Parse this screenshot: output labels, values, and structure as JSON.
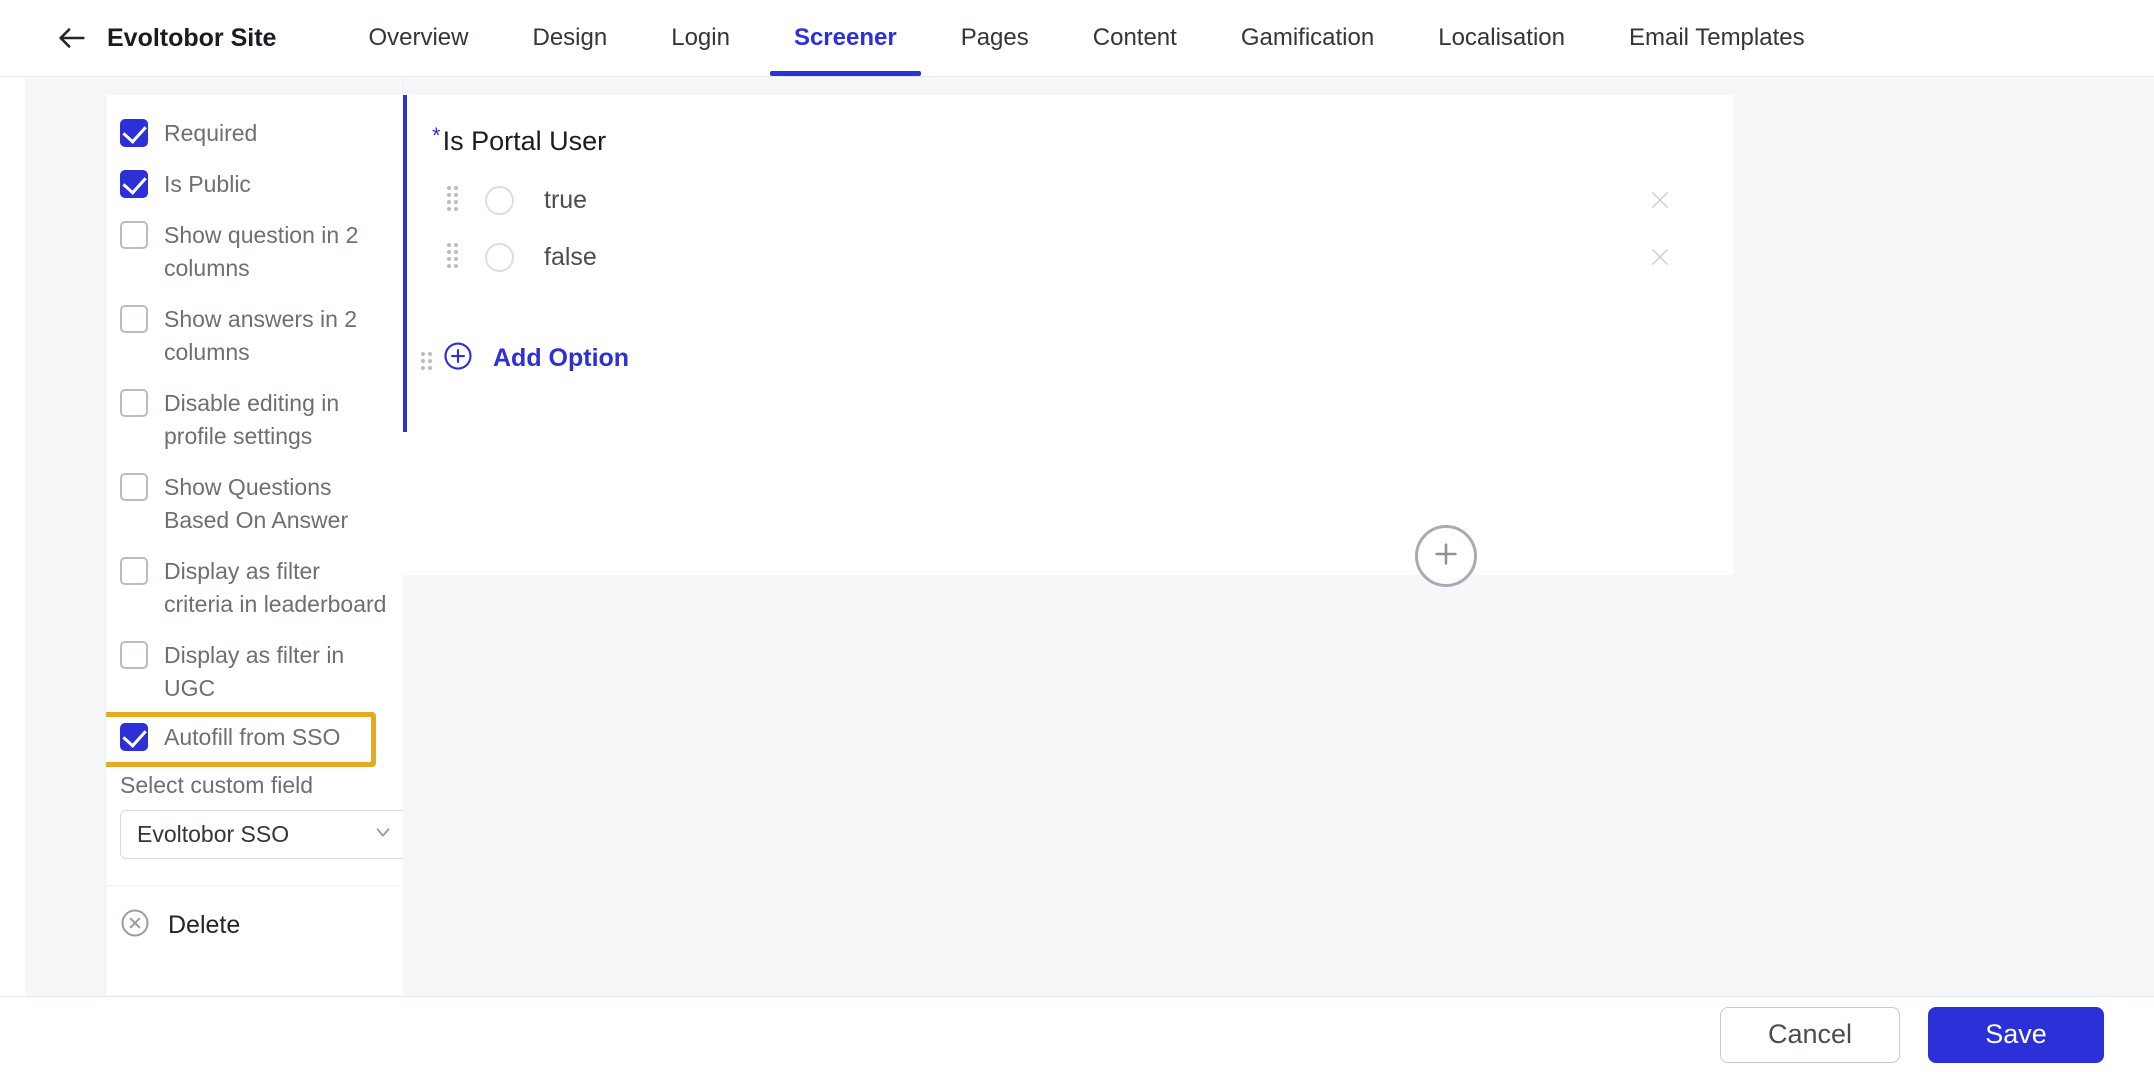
{
  "topnav": {
    "back_icon": "arrow-left-icon",
    "site_title": "Evoltobor Site",
    "tabs": [
      {
        "label": "Overview",
        "active": false
      },
      {
        "label": "Design",
        "active": false
      },
      {
        "label": "Login",
        "active": false
      },
      {
        "label": "Screener",
        "active": true
      },
      {
        "label": "Pages",
        "active": false
      },
      {
        "label": "Content",
        "active": false
      },
      {
        "label": "Gamification",
        "active": false
      },
      {
        "label": "Localisation",
        "active": false
      },
      {
        "label": "Email Templates",
        "active": false
      }
    ]
  },
  "sidebar": {
    "checkboxes": [
      {
        "label": "Required",
        "checked": true
      },
      {
        "label": "Is Public",
        "checked": true
      },
      {
        "label": "Show question in 2 columns",
        "checked": false
      },
      {
        "label": "Show answers in 2 columns",
        "checked": false
      },
      {
        "label": "Disable editing in profile settings",
        "checked": false
      },
      {
        "label": "Show Questions Based On Answer",
        "checked": false
      },
      {
        "label": "Display as filter criteria in leaderboard",
        "checked": false
      },
      {
        "label": "Display as filter in UGC",
        "checked": false
      }
    ],
    "autofill": {
      "label": "Autofill from SSO",
      "checked": true,
      "highlighted": true
    },
    "custom_field": {
      "label": "Select custom field",
      "value": "Evoltobor SSO",
      "chevron_icon": "chevron-down-icon"
    },
    "delete": {
      "label": "Delete",
      "icon": "close-circle-icon"
    }
  },
  "editor": {
    "question": {
      "required_marker": "*",
      "title": "Is Portal User",
      "drag_handle_icon": "drag-handle-icon",
      "options": [
        {
          "label": "true",
          "remove_icon": "close-icon",
          "radio_selected": false
        },
        {
          "label": "false",
          "remove_icon": "close-icon",
          "radio_selected": false
        }
      ],
      "add_option": {
        "label": "Add Option",
        "icon": "plus-circle-icon"
      }
    },
    "add_block": {
      "icon": "plus-circle-icon",
      "label": ""
    }
  },
  "footer": {
    "cancel_label": "Cancel",
    "save_label": "Save"
  },
  "colors": {
    "accent_blue": "#2b30d8",
    "highlight_orange": "#e6a923",
    "panel_gray": "#f6f7f9",
    "text_muted": "#6b6f77"
  }
}
